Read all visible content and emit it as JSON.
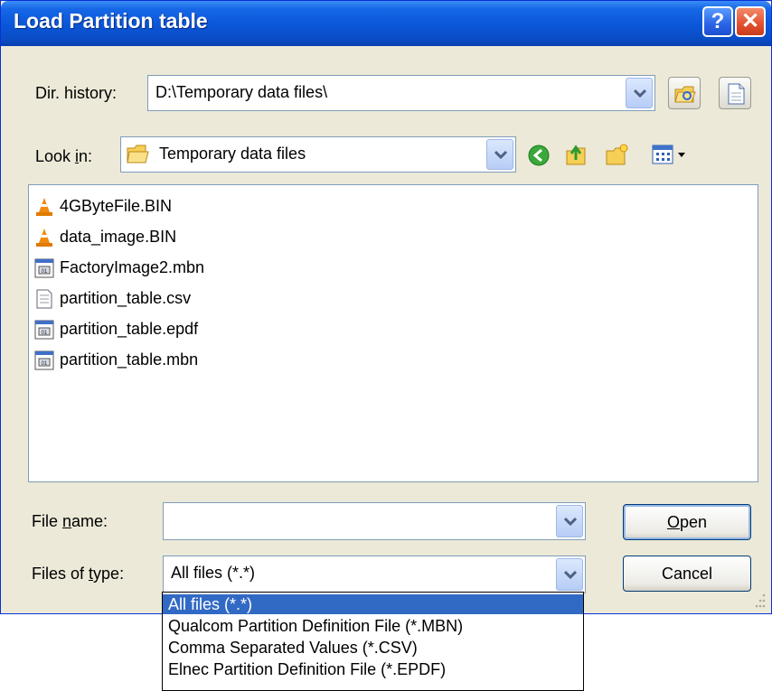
{
  "window": {
    "title": "Load Partition table",
    "help_glyph": "?",
    "close_glyph": "✕"
  },
  "dir_history": {
    "label": "Dir. history:",
    "value": "D:\\Temporary data files\\"
  },
  "look_in": {
    "label_pre": "Look ",
    "label_key": "i",
    "label_post": "n:",
    "value": "Temporary data files"
  },
  "files": [
    {
      "name": "4GByteFile.BIN",
      "icon": "vlc-cone-icon"
    },
    {
      "name": "data_image.BIN",
      "icon": "vlc-cone-icon"
    },
    {
      "name": "FactoryImage2.mbn",
      "icon": "binary-file-icon"
    },
    {
      "name": "partition_table.csv",
      "icon": "text-file-icon"
    },
    {
      "name": "partition_table.epdf",
      "icon": "binary-file-icon"
    },
    {
      "name": "partition_table.mbn",
      "icon": "binary-file-icon"
    }
  ],
  "file_name": {
    "label_pre": "File ",
    "label_key": "n",
    "label_post": "ame:",
    "value": ""
  },
  "file_type": {
    "label_pre": "Files of ",
    "label_key": "t",
    "label_post": "ype:",
    "value": "All files (*.*)",
    "options": [
      "All files (*.*)",
      "Qualcom Partition Definition File (*.MBN)",
      "Comma Separated Values (*.CSV)",
      "Elnec Partition Definition File (*.EPDF)"
    ],
    "selected_index": 0
  },
  "buttons": {
    "open_key": "O",
    "open_rest": "pen",
    "cancel": "Cancel"
  },
  "colors": {
    "titlebar": "#0a56d8",
    "dialog_bg": "#ece9d8",
    "selection": "#316ac5"
  }
}
